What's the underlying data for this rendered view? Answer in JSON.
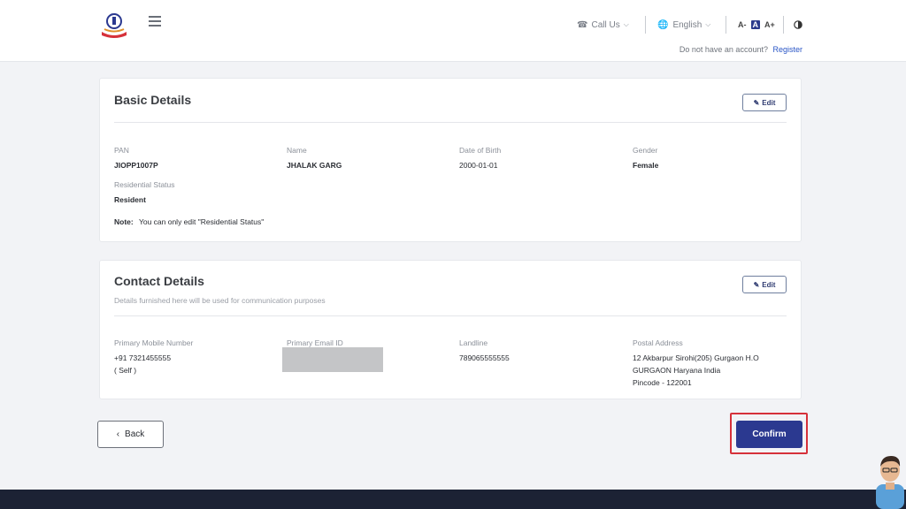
{
  "header": {
    "call_label": "Call Us",
    "language_label": "English",
    "font_small": "A-",
    "font_default": "A",
    "font_large": "A+",
    "account_prompt": "Do not have an account?",
    "register_label": "Register"
  },
  "basic_details": {
    "title": "Basic Details",
    "edit_label": "Edit",
    "fields": [
      {
        "label": "PAN",
        "value": "JIOPP1007P"
      },
      {
        "label": "Name",
        "value": "JHALAK GARG"
      },
      {
        "label": "Date of Birth",
        "value": "2000-01-01"
      },
      {
        "label": "Gender",
        "value": "Female"
      },
      {
        "label": "Residential Status",
        "value": "Resident"
      }
    ],
    "note_label": "Note:",
    "note_text": "You can only edit \"Residential Status\""
  },
  "contact_details": {
    "title": "Contact Details",
    "subtitle": "Details furnished here will be used for communication purposes",
    "edit_label": "Edit",
    "mobile": {
      "label": "Primary Mobile Number",
      "value": "+91 7321455555",
      "extra": "( Self )"
    },
    "email": {
      "label": "Primary Email ID"
    },
    "landline": {
      "label": "Landline",
      "value": "789065555555"
    },
    "address": {
      "label": "Postal Address",
      "line1": "12 Akbarpur Sirohi(205) Gurgaon H.O",
      "line2": "GURGAON Haryana India",
      "line3": "Pincode - 122001"
    }
  },
  "actions": {
    "back_label": "Back",
    "confirm_label": "Confirm"
  },
  "colors": {
    "primary": "#2b3990",
    "highlight": "#d6313a",
    "footer": "#1c2234"
  }
}
